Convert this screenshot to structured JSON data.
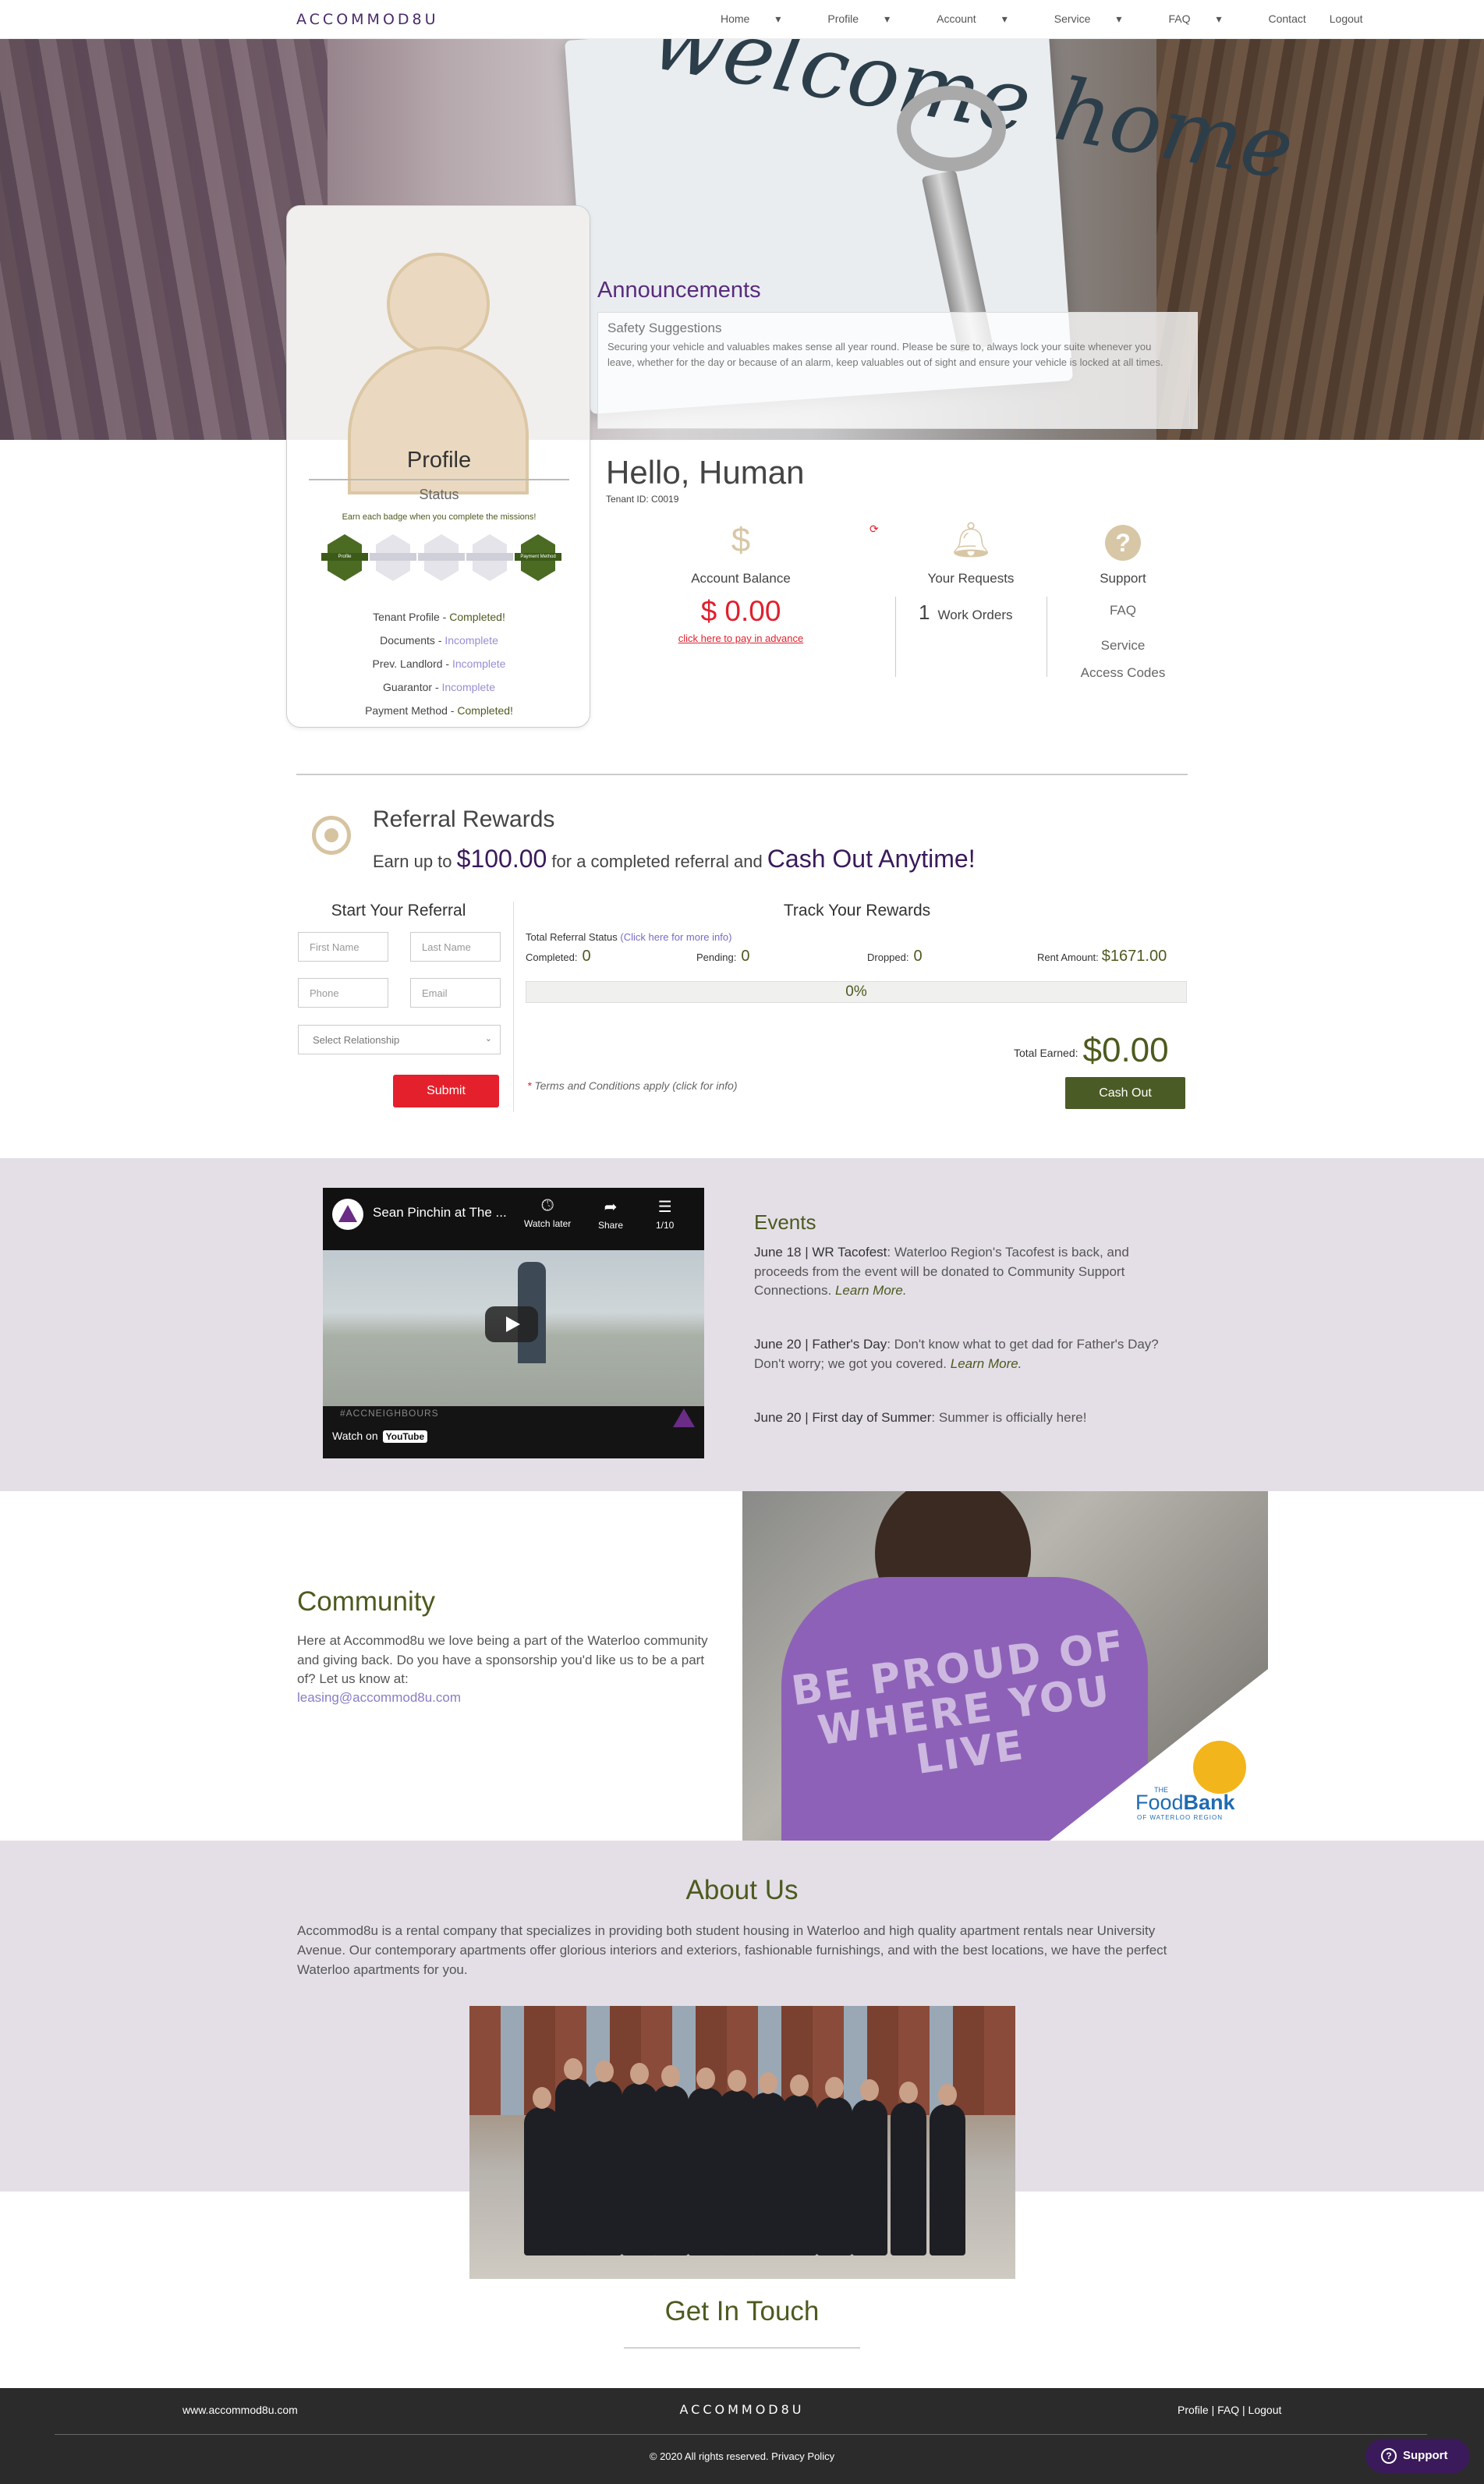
{
  "nav": {
    "logo": "ACCOMMOD8U",
    "items": [
      "Home",
      "Profile",
      "Account",
      "Service",
      "FAQ",
      "Contact",
      "Logout"
    ]
  },
  "hero": {
    "writing": "welcome home"
  },
  "announcements": {
    "title": "Announcements",
    "item_title": "Safety Suggestions",
    "item_text": "Securing your vehicle and valuables makes sense all year round. Please be sure to, always lock your suite whenever you leave, whether for the day or because of an alarm, keep valuables out of sight and ensure your vehicle is locked at all times."
  },
  "profile": {
    "title": "Profile",
    "status": "Status",
    "earn_text": "Earn each badge when you complete the missions!",
    "badge_labels": [
      "Profile",
      "",
      "",
      "",
      "Payment Method"
    ],
    "badge_states": [
      "on",
      "off",
      "off",
      "off",
      "on"
    ],
    "missions": [
      {
        "label": "Tenant Profile - ",
        "state": "Completed!"
      },
      {
        "label": "Documents - ",
        "state": "Incomplete"
      },
      {
        "label": "Prev. Landlord - ",
        "state": "Incomplete"
      },
      {
        "label": "Guarantor - ",
        "state": "Incomplete"
      },
      {
        "label": "Payment Method - ",
        "state": "Completed!"
      }
    ]
  },
  "greeting": {
    "hello": "Hello, Human",
    "tenant_id": "Tenant ID: C0019"
  },
  "account": {
    "icon": "dollar-icon",
    "label": "Account Balance",
    "amount": "$ 0.00",
    "pay_link": "click here to pay in advance"
  },
  "requests": {
    "icon": "bell-icon",
    "label": "Your Requests",
    "count": "1",
    "count_label": "Work Orders"
  },
  "support": {
    "icon": "question-icon",
    "label": "Support",
    "links": [
      "FAQ",
      "Service",
      "Access Codes"
    ]
  },
  "referral": {
    "title": "Referral Rewards",
    "sub_pre": "Earn up to ",
    "sub_amount": "$100.00",
    "sub_mid": " for a completed referral and ",
    "sub_cash": "Cash Out Anytime!",
    "start_title": "Start Your Referral",
    "placeholders": {
      "first": "First Name",
      "last": "Last Name",
      "phone": "Phone",
      "email": "Email"
    },
    "relationship": "Select Relationship",
    "submit": "Submit",
    "track_title": "Track Your Rewards",
    "status_label": "Total Referral Status ",
    "status_link": "(Click here for more info)",
    "completed_label": "Completed:",
    "completed": "0",
    "pending_label": "Pending:",
    "pending": "0",
    "dropped_label": "Dropped:",
    "dropped": "0",
    "rent_label": "Rent Amount:",
    "rent": "$1671.00",
    "progress": "0%",
    "terms": "Terms and Conditions apply (click for info)",
    "total_label": "Total Earned:",
    "total": "$0.00",
    "cashout": "Cash Out"
  },
  "video": {
    "title": "Sean Pinchin at The ...",
    "watch_later": "Watch later",
    "share": "Share",
    "playlist": "1/10",
    "tag": "#ACCNEIGHBOURS",
    "watch_on": "Watch on",
    "youtube": "YouTube"
  },
  "events": {
    "title": "Events",
    "items": [
      {
        "date": "June 18 | ",
        "name": "WR Tacofest",
        "text": ": Waterloo Region's Tacofest is back, and proceeds from the event will be donated to Community Support Connections. ",
        "link": "Learn More."
      },
      {
        "date": "June 20 | ",
        "name": "Father's Day",
        "text": ": Don't know what to get dad for Father's Day? Don't worry; we got you covered. ",
        "link": "Learn More."
      },
      {
        "date": "June 20 | ",
        "name": "First day of Summer",
        "text": ": Summer is officially here!",
        "link": ""
      }
    ]
  },
  "community": {
    "title": "Community",
    "text": "Here at Accommod8u we love being a part of the Waterloo community and giving back. Do you have a sponsorship you'd like us to be a part of? Let us know at:",
    "email": "leasing@accommod8u.com",
    "shirt_slogan": "BE PROUD OF WHERE YOU LIVE",
    "foodbank_the": "THE",
    "foodbank_food": "Food",
    "foodbank_bank": "Bank",
    "foodbank_sub": "OF WATERLOO REGION"
  },
  "about": {
    "title": "About Us",
    "text": "Accommod8u is a rental company that specializes in providing both student housing in Waterloo and high quality apartment rentals near University Avenue. Our contemporary apartments offer glorious interiors and exteriors, fashionable furnishings, and with the best locations, we have the perfect Waterloo apartments for you."
  },
  "contact": {
    "title": "Get In Touch"
  },
  "footer": {
    "site": "www.accommod8u.com",
    "logo": "ACCOMMOD8U",
    "links": [
      "Profile",
      "FAQ",
      "Logout"
    ],
    "copyright": "© 2020 All rights reserved. ",
    "privacy": "Privacy Policy",
    "support": "Support"
  },
  "colors": {
    "brand_purple": "#4b2a6b",
    "olive": "#4d5a1f",
    "accent_red": "#e4202c",
    "lavender_bg": "#e4dfe7",
    "incomplete": "#9a8cd4"
  }
}
